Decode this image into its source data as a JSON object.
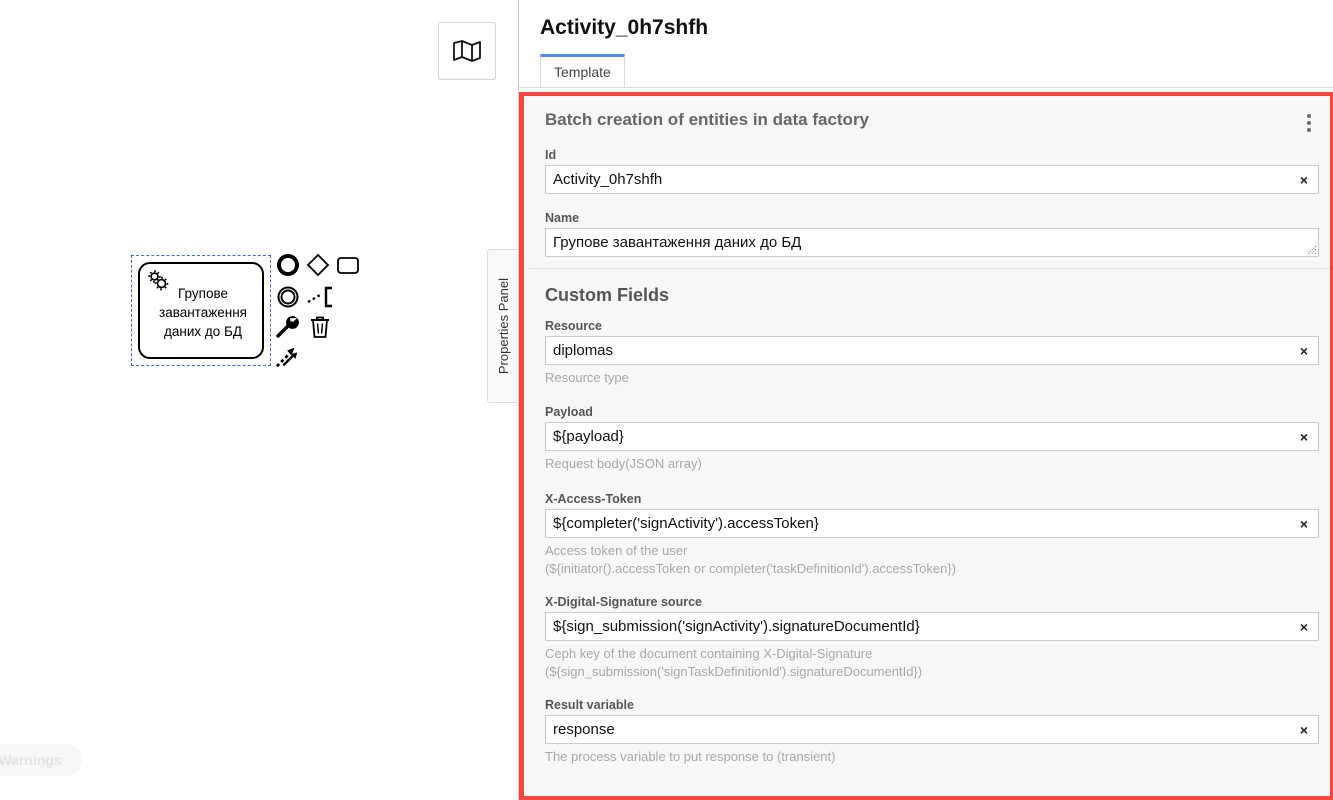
{
  "canvas": {
    "minimap_button": {
      "icon": "map-icon",
      "label": "Toggle minimap"
    },
    "task": {
      "icon": "service-task-gear-icon",
      "label": "Групове завантаження даних до БД"
    },
    "context_pad": [
      {
        "icon": "end-event-circle-icon",
        "label": "Append EndEvent"
      },
      {
        "icon": "gateway-diamond-icon",
        "label": "Append Gateway"
      },
      {
        "icon": "task-rectangle-icon",
        "label": "Append Task"
      },
      {
        "icon": "intermediate-event-circle-icon",
        "label": "Append Intermediate/Boundary Event"
      },
      {
        "icon": "append-text-annotation-icon",
        "label": "Append TextAnnotation"
      },
      {
        "icon": "wrench-icon",
        "label": "Change type"
      },
      {
        "icon": "trash-icon",
        "label": "Remove"
      },
      {
        "icon": "connect-arrow-icon",
        "label": "Connect"
      }
    ],
    "properties_panel_tab": "Properties Panel",
    "warnings_pill": "Warnings"
  },
  "panel": {
    "title": "Activity_0h7shfh",
    "tabs": [
      {
        "label": "Template",
        "active": true
      }
    ],
    "template": {
      "header": "Batch creation of entities in data factory",
      "menu_icon": "kebab-menu-icon",
      "clear_icon": "×",
      "fields": [
        {
          "label": "Id",
          "value": "Activity_0h7shfh",
          "hint": "",
          "type": "input",
          "clearable": true
        },
        {
          "label": "Name",
          "value": "Групове завантаження даних до БД",
          "hint": "",
          "type": "textarea",
          "clearable": false
        }
      ],
      "custom_fields_title": "Custom Fields",
      "custom_fields": [
        {
          "label": "Resource",
          "value": "diplomas",
          "hint": "Resource type",
          "type": "input",
          "clearable": true
        },
        {
          "label": "Payload",
          "value": "${payload}",
          "hint": "Request body(JSON array)",
          "type": "input",
          "clearable": true
        },
        {
          "label": "X-Access-Token",
          "value": "${completer('signActivity').accessToken}",
          "hint": "Access token of the user\n(${initiator().accessToken or completer('taskDefinitionId').accessToken})",
          "type": "input",
          "clearable": true
        },
        {
          "label": "X-Digital-Signature source",
          "value": "${sign_submission('signActivity').signatureDocumentId}",
          "hint": "Ceph key of the document containing X-Digital-Signature\n(${sign_submission('signTaskDefinitionId').signatureDocumentId})",
          "type": "input",
          "clearable": true
        },
        {
          "label": "Result variable",
          "value": "response",
          "hint": "The process variable to put response to (transient)",
          "type": "input",
          "clearable": true
        }
      ]
    }
  },
  "colors": {
    "highlight_border": "#f4483f",
    "active_tab_underline": "#4a90e2",
    "selection_outline": "#3a6fd8",
    "panel_background": "#f7f7f7"
  }
}
